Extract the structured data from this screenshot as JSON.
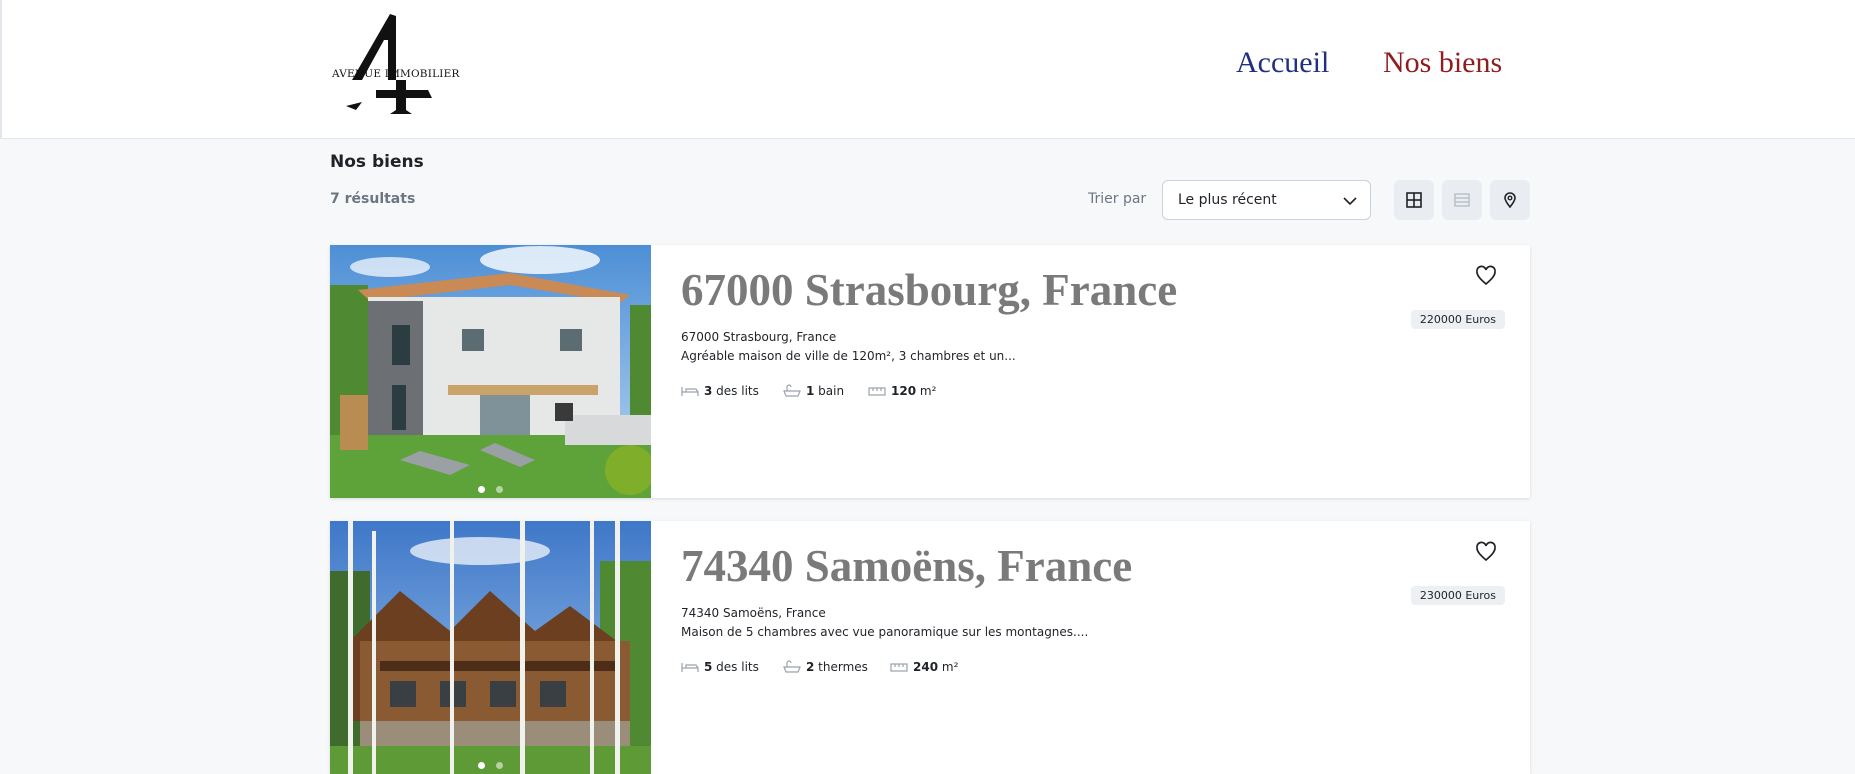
{
  "header": {
    "logo_text": "AVENUE IMMOBILIER",
    "nav": {
      "home": "Accueil",
      "biens": "Nos biens"
    }
  },
  "listing": {
    "title": "Nos biens",
    "result_count": "7 résultats",
    "sort_label": "Trier par",
    "sort_value": "Le plus récent",
    "views": [
      "grid-view-icon",
      "list-view-icon",
      "map-pin-icon"
    ]
  },
  "properties": [
    {
      "title": "67000 Strasbourg, France",
      "address": "67000 Strasbourg, France",
      "description": "Agréable maison de ville de 120m², 3 chambres et un...",
      "price": "220000 Euros",
      "beds_count": "3",
      "beds_label": " des lits",
      "baths_count": "1",
      "baths_label": " bain",
      "area_count": "120",
      "area_label": " m²",
      "carousel": {
        "slides": 2,
        "active": 1
      }
    },
    {
      "title": "74340 Samoëns, France",
      "address": "74340 Samoëns, France",
      "description": "Maison de 5 chambres avec vue panoramique sur les montagnes....",
      "price": "230000 Euros",
      "beds_count": "5",
      "beds_label": " des lits",
      "baths_count": "2",
      "baths_label": " thermes",
      "area_count": "240",
      "area_label": " m²",
      "carousel": {
        "slides": 2,
        "active": 1
      }
    }
  ],
  "colors": {
    "nav_home": "#20307f",
    "nav_active": "#8f1c1f",
    "title_grey": "#7a7a7a",
    "background": "#f7f8fa"
  }
}
